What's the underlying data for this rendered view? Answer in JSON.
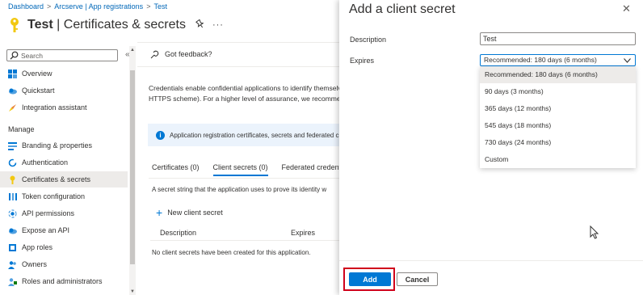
{
  "breadcrumb": [
    "Dashboard",
    "Arcserve | App registrations",
    "Test"
  ],
  "title": {
    "app": "Test",
    "section": "Certificates & secrets"
  },
  "search": {
    "placeholder": "Search"
  },
  "sidebar": {
    "top_items": [
      {
        "label": "Overview",
        "icon": "grid-icon"
      },
      {
        "label": "Quickstart",
        "icon": "cloud-icon"
      },
      {
        "label": "Integration assistant",
        "icon": "rocket-icon"
      }
    ],
    "section_label": "Manage",
    "manage_items": [
      {
        "label": "Branding & properties",
        "icon": "branding-icon"
      },
      {
        "label": "Authentication",
        "icon": "refresh-icon"
      },
      {
        "label": "Certificates & secrets",
        "icon": "key-icon",
        "active": true
      },
      {
        "label": "Token configuration",
        "icon": "bars-icon"
      },
      {
        "label": "API permissions",
        "icon": "api-icon"
      },
      {
        "label": "Expose an API",
        "icon": "cloud-icon"
      },
      {
        "label": "App roles",
        "icon": "roles-icon"
      },
      {
        "label": "Owners",
        "icon": "people-icon"
      },
      {
        "label": "Roles and administrators",
        "icon": "admin-icon"
      }
    ]
  },
  "main": {
    "feedback": "Got feedback?",
    "description_lines": [
      "Credentials enable confidential applications to identify themselv",
      "HTTPS scheme). For a higher level of assurance, we recommend"
    ],
    "info": "Application registration certificates, secrets and federated cre",
    "tabs": [
      "Certificates (0)",
      "Client secrets (0)",
      "Federated credenti"
    ],
    "tab_text": "A secret string that the application uses to prove its identity w",
    "new_secret": "New client secret",
    "columns": [
      "Description",
      "Expires"
    ],
    "empty_message": "No client secrets have been created for this application."
  },
  "panel": {
    "title": "Add a client secret",
    "description_label": "Description",
    "description_value": "Test",
    "expires_label": "Expires",
    "expires_selected": "Recommended: 180 days (6 months)",
    "options": [
      "Recommended: 180 days (6 months)",
      "90 days (3 months)",
      "365 days (12 months)",
      "545 days (18 months)",
      "730 days (24 months)",
      "Custom"
    ],
    "add_label": "Add",
    "cancel_label": "Cancel"
  },
  "colors": {
    "accent": "#0078d4",
    "highlight": "#d0021b",
    "key": "#f2c811"
  }
}
